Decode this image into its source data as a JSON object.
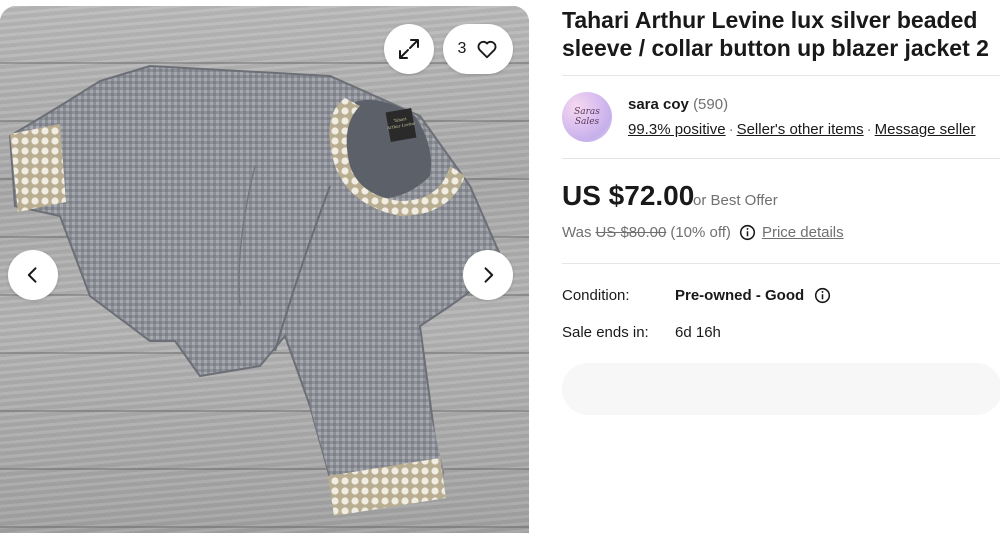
{
  "gallery": {
    "image_count": "3",
    "icons": {
      "expand": "expand-icon",
      "favorite": "heart-icon",
      "prev": "chevron-left-icon",
      "next": "chevron-right-icon"
    },
    "label_lines": [
      "Tahari",
      "Arthur Levine"
    ]
  },
  "listing": {
    "title_line1": "Tahari Arthur Levine lux silver beaded",
    "title_line2": "sleeve / collar button up blazer jacket 2"
  },
  "seller": {
    "avatar_line1": "Saras",
    "avatar_line2": "Sales",
    "name": "sara coy",
    "feedback_count": "(590)",
    "positive": "99.3% positive",
    "other_items": "Seller's other items",
    "message": "Message seller",
    "separator": "·"
  },
  "pricing": {
    "price": "US $72.00",
    "best_offer": "or Best Offer",
    "was_label": "Was",
    "was_price": "US $80.00",
    "discount": "(10% off)",
    "details_link": "Price details",
    "info_icon": "info-icon"
  },
  "details": {
    "condition_label": "Condition:",
    "condition_value": "Pre-owned - Good",
    "sale_ends_label": "Sale ends in:",
    "sale_ends_value": "6d 16h"
  },
  "colors": {
    "text": "#191919",
    "secondary_text": "#707070",
    "divider": "#e5e5e5"
  }
}
